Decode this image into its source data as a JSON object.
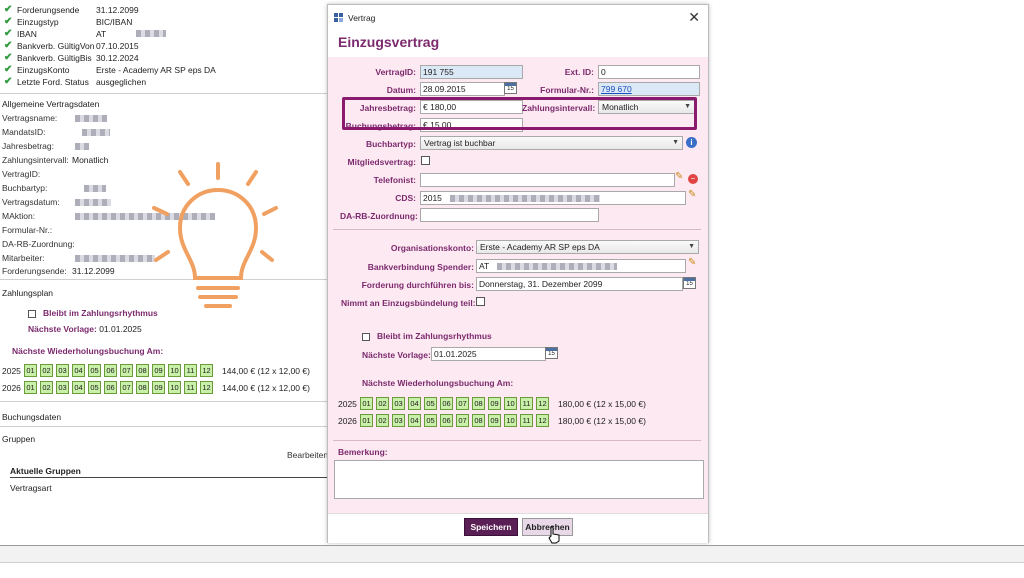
{
  "left": {
    "status_rows": [
      {
        "label": "Forderungsende",
        "value": "31.12.2099"
      },
      {
        "label": "Einzugstyp",
        "value": "BIC/IBAN"
      },
      {
        "label": "IBAN",
        "value": "AT"
      },
      {
        "label": "Bankverb. GültigVon",
        "value": "07.10.2015"
      },
      {
        "label": "Bankverb. GültigBis",
        "value": "30.12.2024"
      },
      {
        "label": "EinzugsKonto",
        "value": "Erste - Academy AR SP eps DA"
      },
      {
        "label": "Letzte Ford. Status",
        "value": "ausgeglichen"
      }
    ],
    "section_general": "Allgemeine Vertragsdaten",
    "general_rows": [
      {
        "label": "Vertragsname:",
        "value": ""
      },
      {
        "label": "MandatsID:",
        "value": ""
      },
      {
        "label": "Jahresbetrag:",
        "value": ""
      },
      {
        "label": "Zahlungsintervall:",
        "value": "Monatlich"
      },
      {
        "label": "VertragID:",
        "value": ""
      },
      {
        "label": "Buchbartyp:",
        "value": ""
      },
      {
        "label": "Vertragsdatum:",
        "value": ""
      },
      {
        "label": "MAktion:",
        "value": ""
      },
      {
        "label": "Formular-Nr.:",
        "value": ""
      },
      {
        "label": "DA-RB-Zuordnung:",
        "value": ""
      },
      {
        "label": "Mitarbeiter:",
        "value": ""
      },
      {
        "label": "Forderungsende:",
        "value": "31.12.2099"
      }
    ],
    "section_plan": "Zahlungsplan",
    "keep_rhythm_label": "Bleibt im Zahlungsrhythmus",
    "next_template_label": "Nächste Vorlage:",
    "next_template_value": "01.01.2025",
    "next_recurring_label": "Nächste Wiederholungsbuchung Am:",
    "months": [
      "01",
      "02",
      "03",
      "04",
      "05",
      "06",
      "07",
      "08",
      "09",
      "10",
      "11",
      "12"
    ],
    "plan_rows": [
      {
        "year": "2025",
        "total": "144,00 € (12 x 12,00 €)"
      },
      {
        "year": "2026",
        "total": "144,00 € (12 x 12,00 €)"
      }
    ],
    "section_booking": "Buchungsdaten",
    "groups_label": "Gruppen",
    "edit_link": "Bearbeiten",
    "current_groups": "Aktuelle Gruppen",
    "contract_type": "Vertragsart"
  },
  "dialog": {
    "window_title": "Vertrag",
    "heading": "Einzugsvertrag",
    "fields": {
      "vertragid_label": "VertragID:",
      "vertragid_value": "191 755",
      "extid_label": "Ext. ID:",
      "extid_value": "0",
      "datum_label": "Datum:",
      "datum_value": "28.09.2015",
      "formular_label": "Formular-Nr.:",
      "formular_value": "799 670",
      "jahresbetrag_label": "Jahresbetrag:",
      "jahresbetrag_value": "€ 180,00",
      "intervall_label": "Zahlungsintervall:",
      "intervall_value": "Monatlich",
      "buchungsbetrag_label": "Buchungsbetrag:",
      "buchungsbetrag_value": "€ 15,00",
      "buchbartyp_label": "Buchbartyp:",
      "buchbartyp_value": "Vertrag ist buchbar",
      "mitglied_label": "Mitgliedsvertrag:",
      "telefonist_label": "Telefonist:",
      "cds_label": "CDS:",
      "cds_value": "2015",
      "darb_label": "DA-RB-Zuordnung:",
      "orgkonto_label": "Organisationskonto:",
      "orgkonto_value": "Erste - Academy AR SP eps DA",
      "bank_label": "Bankverbindung Spender:",
      "bank_value": "AT",
      "forderung_label": "Forderung durchführen bis:",
      "forderung_value": "Donnerstag, 31. Dezember 2099",
      "buendelung_label": "Nimmt an Einzugsbündelung teil:"
    },
    "keep_rhythm_label": "Bleibt im Zahlungsrhythmus",
    "next_template_label": "Nächste Vorlage:",
    "next_template_value": "01.01.2025",
    "next_recurring_label": "Nächste Wiederholungsbuchung Am:",
    "months": [
      "01",
      "02",
      "03",
      "04",
      "05",
      "06",
      "07",
      "08",
      "09",
      "10",
      "11",
      "12"
    ],
    "plan_rows": [
      {
        "year": "2025",
        "total": "180,00 € (12 x 15,00 €)"
      },
      {
        "year": "2026",
        "total": "180,00 € (12 x 15,00 €)"
      }
    ],
    "remark_label": "Bemerkung:",
    "save_label": "Speichern",
    "cancel_label": "Abbrechen"
  },
  "colors": {
    "accent": "#7b2a6e",
    "dialog_bg": "#fde9f1",
    "month_bg": "#c8f0a8",
    "bulb": "#f0a060"
  }
}
